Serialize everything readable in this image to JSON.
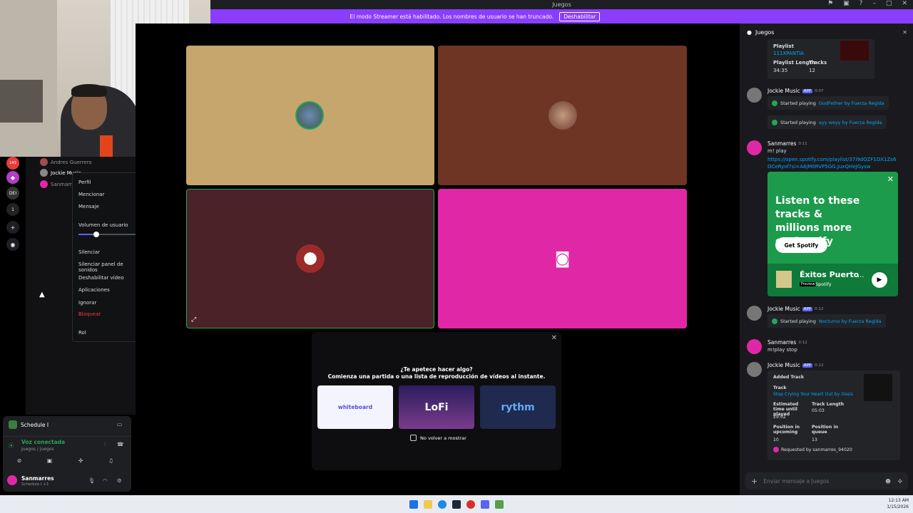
{
  "titlebar": {
    "title": "Juegos"
  },
  "streamer": {
    "text": "El modo Streamer está habilitado. Los nombres de usuario se han truncado.",
    "button": "Deshabilitar"
  },
  "guilds": {
    "badge1": "143",
    "badge2": "DEI",
    "badge3": "1"
  },
  "members": [
    {
      "name": "Andres Guerrero"
    },
    {
      "name": "Jockie Music"
    },
    {
      "name": "Sanmarres"
    }
  ],
  "context_menu": {
    "profile": "Perfil",
    "mention": "Mencionar",
    "message": "Mensaje",
    "volume_label": "Volumen de usuario",
    "volume_level": 0.27,
    "mute": "Silenciar",
    "mute_soundboard": "Silenciar panel de sonidos",
    "disable_video": "Deshabilitar vídeo",
    "apps": "Aplicaciones",
    "ignore": "Ignorar",
    "block": "Bloquear",
    "role": "Rol"
  },
  "voice_panel": {
    "channel_name": "Schedule I",
    "status": "Voz conectada",
    "location": "Juegos / Juegos",
    "user": "Sanmarres",
    "user_status": "Schedule I +1"
  },
  "activity": {
    "line1": "¿Te apetece hacer algo?",
    "line2": "Comienza una partida o una lista de reproducción de vídeos al instante.",
    "cards": [
      "whiteboard",
      "LoFi",
      "rythm"
    ],
    "dont_show": "No volver a mostrar"
  },
  "chat": {
    "channel": "Juegos",
    "playlist_label": "Playlist",
    "playlist_name": "111XPANTIA",
    "playlist_length_label": "Playlist Length",
    "playlist_length": "34:35",
    "tracks_label": "Tracks",
    "tracks": "12",
    "messages": [
      {
        "author": "Jockie Music",
        "badge": "APP",
        "time": "0:07",
        "text": "Started playing",
        "link": "GodFether by Fuerza Regida"
      },
      {
        "text": "Started playing",
        "link": "ayy weyy by Fuerza Regida"
      },
      {
        "author": "Sanmarres",
        "time": "0:11",
        "text": "m! play",
        "link": "https://open.spotify.com/playlist/37i9dQZF1DX1Zs6DCeRyof?si=A8jM0RVP5GG.JuxQHeJGysw"
      },
      {
        "author": "Jockie Music",
        "badge": "APP",
        "time": "0:12",
        "text": "Started playing",
        "link": "Nocturno by Fuerza Regida"
      },
      {
        "author": "Sanmarres",
        "time": "0:12",
        "text": "m!play stop"
      },
      {
        "author": "Jockie Music",
        "badge": "APP",
        "time": "0:12"
      }
    ],
    "spotify": {
      "headline": "Listen to these tracks & millions more on Spotify",
      "cta": "Get Spotify",
      "title": "Éxitos Puerto",
      "preview": "Preview",
      "source": "Spotify"
    },
    "added": {
      "title": "Added Track",
      "track_label": "Track",
      "track": "Stop Crying Your Heart Out by Oasis",
      "est_label": "Estimated time until played",
      "est": "29:02",
      "len_label": "Track Length",
      "len": "05:03",
      "pos_up_label": "Position in upcoming",
      "pos_up": "10",
      "pos_q_label": "Position in queue",
      "pos_q": "13",
      "requested": "Requested by sanmarres_94020"
    },
    "input_placeholder": "Enviar mensaje a Juegos"
  },
  "taskbar": {
    "time": "12:13 AM",
    "date": "1/15/2026"
  },
  "colors": {
    "accent": "#5865f2",
    "streamer": "#8b3dff",
    "tile1": "#c6a66c",
    "tile2": "#6e3525",
    "tile3": "#4a2228",
    "tile4": "#e028a6",
    "spotify": "#1d9b4c"
  }
}
